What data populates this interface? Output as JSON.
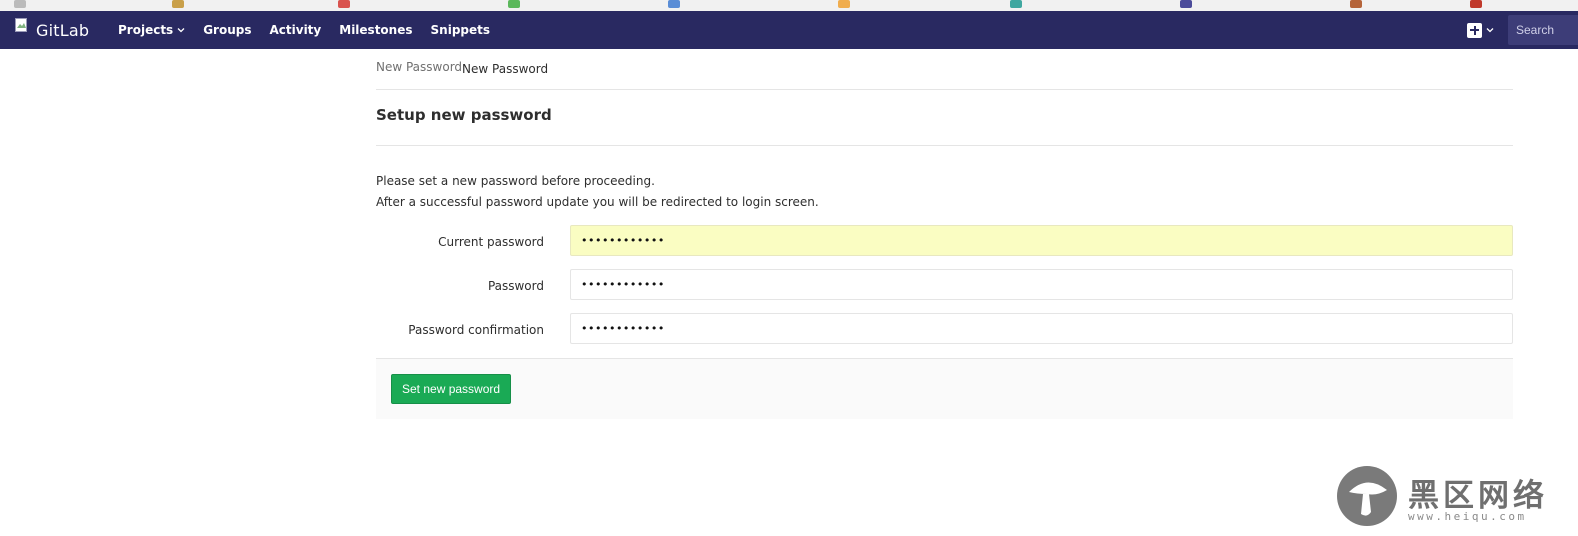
{
  "navbar": {
    "brand": "GitLab",
    "links": [
      {
        "label": "Projects",
        "has_dropdown": true
      },
      {
        "label": "Groups"
      },
      {
        "label": "Activity"
      },
      {
        "label": "Milestones"
      },
      {
        "label": "Snippets"
      }
    ],
    "search_placeholder": "Search"
  },
  "breadcrumb": {
    "items": [
      "New Password",
      "New Password"
    ]
  },
  "page": {
    "title": "Setup new password",
    "intro_line_1": "Please set a new password before proceeding.",
    "intro_line_2": "After a successful password update you will be redirected to login screen."
  },
  "form": {
    "fields": [
      {
        "label": "Current password",
        "value": "••••••••••••",
        "autofilled": true
      },
      {
        "label": "Password",
        "value": "••••••••••••"
      },
      {
        "label": "Password confirmation",
        "value": "••••••••••••"
      }
    ],
    "submit_label": "Set new password"
  },
  "watermark": {
    "text": "黑区网络",
    "url": "www.heiqu.com"
  },
  "colors": {
    "navbar_bg": "#292961",
    "submit_bg": "#1aaa55",
    "autofill_bg": "#fafdc2"
  }
}
